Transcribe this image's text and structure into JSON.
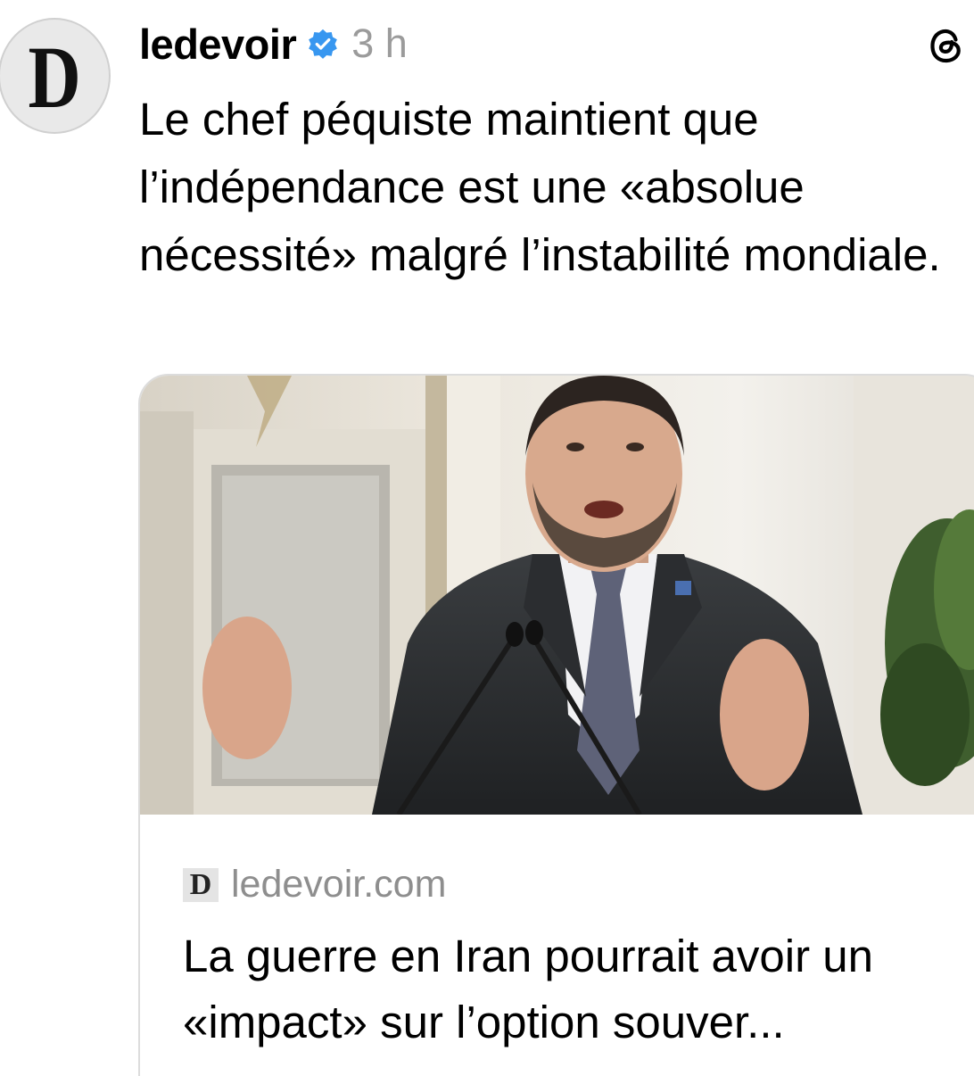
{
  "post": {
    "avatar_letter": "D",
    "username": "ledevoir",
    "verified_icon": "verified-badge-icon",
    "timestamp": "3 h",
    "app_icon": "threads-icon",
    "caption": "Le chef péquiste maintient que l’indépendance est une «absolue nécessité» malgré l’instabilité mondiale."
  },
  "link_card": {
    "favicon_letter": "D",
    "domain": "ledevoir.com",
    "title": "La guerre en Iran pourrait avoir un «impact» sur l’option souver..."
  },
  "colors": {
    "verified": "#3897f0",
    "timestamp": "#9b9b9b",
    "domain": "#8e8e8e",
    "card_border": "#dcdcdc"
  }
}
